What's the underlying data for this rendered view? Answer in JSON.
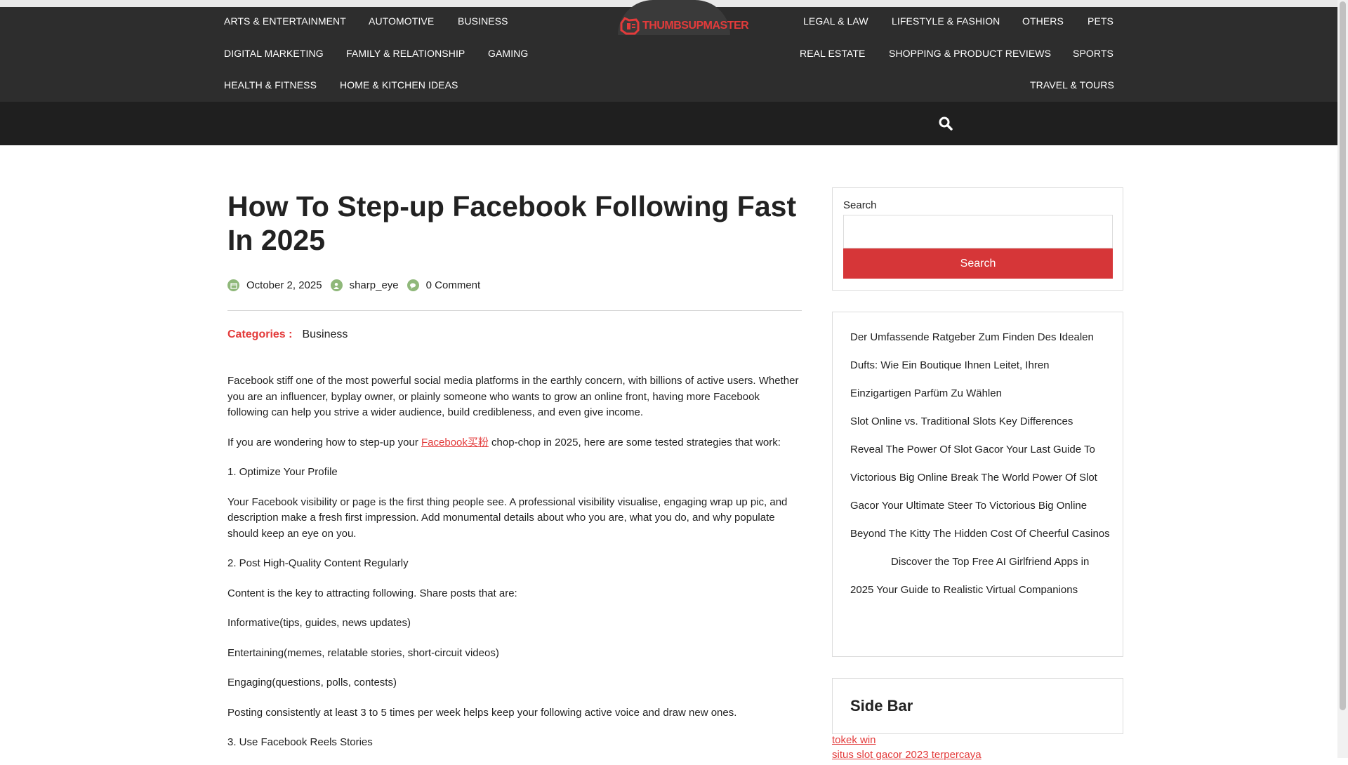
{
  "nav": {
    "left_items": [
      "ARTS & ENTERTAINMENT",
      "AUTOMOTIVE",
      "BUSINESS",
      "DIGITAL MARKETING",
      "FAMILY & RELATIONSHIP",
      "GAMING",
      "HEALTH & FITNESS",
      "HOME & KITCHEN IDEAS"
    ],
    "right_items": [
      "LEGAL & LAW",
      "LIFESTYLE & FASHION",
      "OTHERS",
      "PETS",
      "REAL ESTATE",
      "SHOPPING & PRODUCT REVIEWS",
      "SPORTS",
      "TRAVEL & TOURS"
    ],
    "logo_text": "THUMBSUPMASTER"
  },
  "post": {
    "title": "How To Step-up Facebook Following Fast In 2025",
    "date": "October 2, 2025",
    "author": "sharp_eye",
    "comments": "0 Comment",
    "categories_label": "Categories :",
    "category": "Business",
    "p1": "Facebook stiff one of the most powerful social media platforms in the earthly concern, with billions of active users. Whether you are an influencer, byplay owner, or plainly someone who wants to grow an online front, having more Facebook following can help you strive a wider audience, build credibleness, and even give income.",
    "p2_before": "If you are wondering how to step-up your ",
    "p2_link": "Facebook买粉",
    "p2_after": " chop-chop in 2025, here are some tested strategies that work:",
    "h1": "1. Optimize Your Profile",
    "p3": "Your Facebook visibility or page is the first thing people see. A professional visibility visualise, engaging wrap up pic, and description make a fresh first impression. Add monumental details about who you are, what you do, and why populate should keep an eye on you.",
    "h2": "2. Post High-Quality Content Regularly",
    "p4": "Content is the key to attracting following. Share posts that are:",
    "li1": "Informative(tips, guides, news updates)",
    "li2": "Entertaining(memes, relatable stories, short-circuit videos)",
    "li3": "Engaging(questions, polls, contests)",
    "p5": "Posting consistently at least 3 to 5 times per week helps keep your following active voice and draw new ones.",
    "h3": "3. Use Facebook Reels Stories"
  },
  "sidebar": {
    "search_label": "Search",
    "search_button": "Search",
    "recent_posts": [
      "Der Umfassende Ratgeber Zum Finden Des Idealen Dufts: Wie Ein Boutique Ihnen Leitet, Ihren Einzigartigen Parfüm Zu Wählen",
      "Slot Online vs. Traditional Slots Key Differences",
      "Reveal The Power Of Slot Gacor Your Last Guide To Victorious Big Online Break The World Power Of Slot Gacor Your Ultimate Steer To Victorious Big Online",
      "Beyond The Kitty The Hidden Cost Of Cheerful Casinos",
      "Discover the Top Free AI Girlfriend Apps in 2025 Your Guide to Realistic Virtual Companions"
    ],
    "side_bar_title": "Side Bar",
    "links": [
      "tokek win",
      "situs slot gacor 2023 terpercaya"
    ]
  },
  "colors": {
    "accent": "#e33b3b",
    "header_bg": "#2d2d2d",
    "search_bar_bg": "#1f1f1f",
    "meta_icon": "#8fb87a"
  },
  "icons": {
    "search": "search-icon",
    "date": "calendar-icon",
    "author": "user-icon",
    "comments": "comments-icon"
  }
}
